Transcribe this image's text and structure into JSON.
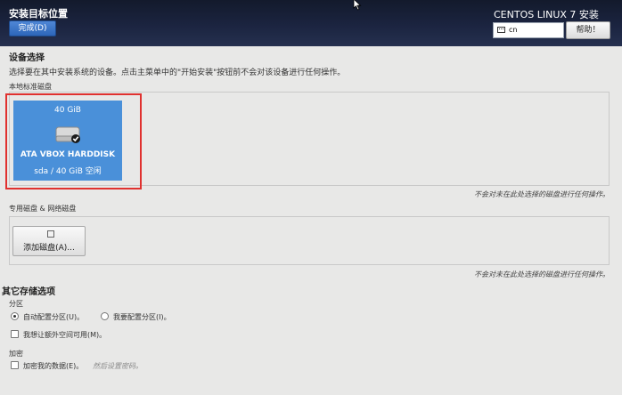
{
  "header": {
    "title": "安装目标位置",
    "done_label": "完成(D)",
    "product": "CENTOS LINUX 7 安装",
    "keyboard_layout": "cn",
    "help_label": "帮助！"
  },
  "device_selection": {
    "title": "设备选择",
    "description": "选择要在其中安装系统的设备。点击主菜单中的\"开始安装\"按钮前不会对该设备进行任何操作。",
    "local_disks_label": "本地标准磁盘",
    "disk": {
      "size": "40 GiB",
      "name": "ATA VBOX HARDDISK",
      "info": "sda   /   40 GiB 空闲",
      "selected": true
    },
    "local_note": "不会对未在此处选择的磁盘进行任何操作。",
    "specialized_label": "专用磁盘 & 网络磁盘",
    "add_disk_label": "添加磁盘(A)...",
    "specialized_note": "不会对未在此处选择的磁盘进行任何操作。"
  },
  "other_storage": {
    "title": "其它存储选项",
    "partitioning_label": "分区",
    "auto_partition_label": "自动配置分区(U)。",
    "manual_partition_label": "我要配置分区(I)。",
    "extra_space_label": "我想让额外空间可用(M)。",
    "encryption_label": "加密",
    "encrypt_label": "加密我的数据(E)。",
    "encrypt_hint": "然后设置密码。"
  },
  "colors": {
    "accent": "#4a90d9",
    "highlight": "#e0312f",
    "header_bg": "#1b2440"
  },
  "icons": [
    "keyboard-icon",
    "harddisk-icon",
    "selected-check-icon",
    "add-disk-icon",
    "mouse-cursor-icon"
  ]
}
